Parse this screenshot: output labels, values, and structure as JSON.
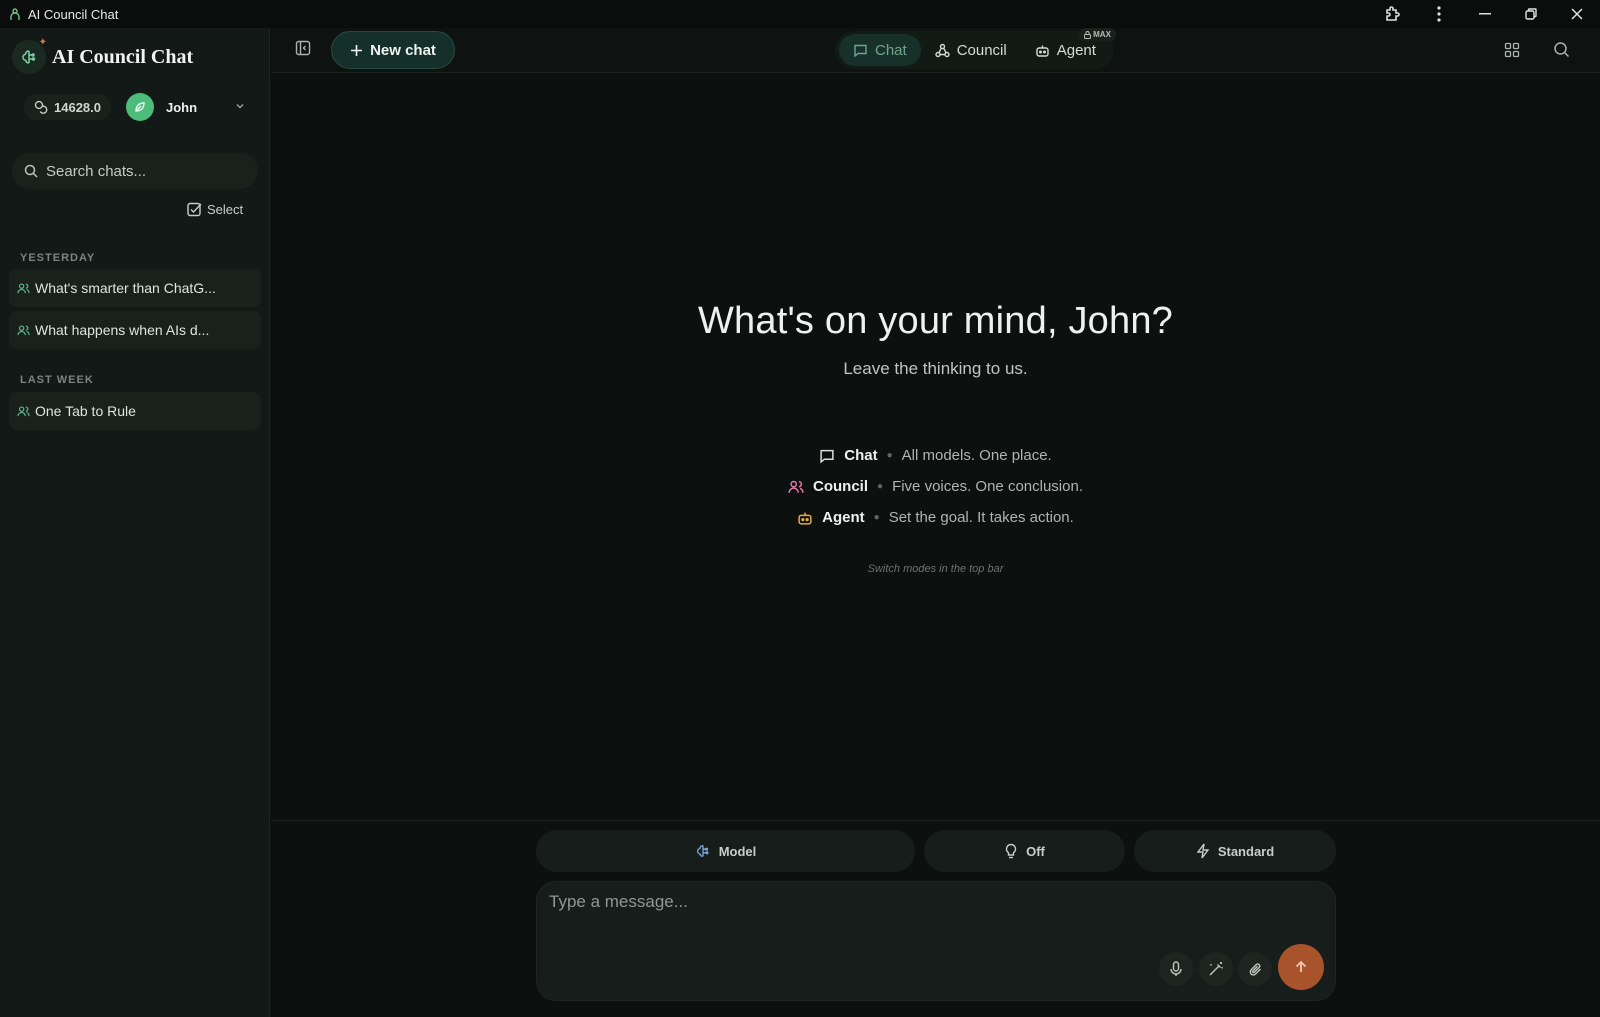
{
  "window": {
    "title": "AI Council Chat"
  },
  "sidebar": {
    "brand": "AI Council Chat",
    "credits": "14628.0",
    "user_name": "John",
    "search_placeholder": "Search chats...",
    "select_label": "Select",
    "groups": [
      {
        "label": "YESTERDAY",
        "items": [
          "What's smarter than ChatG...",
          "What happens when AIs d..."
        ]
      },
      {
        "label": "LAST WEEK",
        "items": [
          "One Tab to Rule"
        ]
      }
    ]
  },
  "topbar": {
    "new_chat": "New chat",
    "modes": [
      {
        "label": "Chat",
        "active": true,
        "icon": "message-square-icon"
      },
      {
        "label": "Council",
        "active": false,
        "icon": "network-icon"
      },
      {
        "label": "Agent",
        "active": false,
        "icon": "bot-icon",
        "badge": "MAX"
      }
    ]
  },
  "main": {
    "greeting": "What's on your mind, John?",
    "subtitle": "Leave the thinking to us.",
    "features": [
      {
        "name": "Chat",
        "desc": "All models. One place.",
        "icon": "message-square-icon",
        "color": "#d9dedb"
      },
      {
        "name": "Council",
        "desc": "Five voices. One conclusion.",
        "icon": "users-icon",
        "color": "#e07ba7"
      },
      {
        "name": "Agent",
        "desc": "Set the goal. It takes action.",
        "icon": "bot-icon",
        "color": "#e6a94a"
      }
    ],
    "hint": "Switch modes in the top bar"
  },
  "composer": {
    "model_label": "Model",
    "thinking_label": "Off",
    "speed_label": "Standard",
    "placeholder": "Type a message...",
    "value": ""
  },
  "colors": {
    "accent": "#6fa58c",
    "send": "#a8532b",
    "avatar": "#4dbb7a"
  }
}
